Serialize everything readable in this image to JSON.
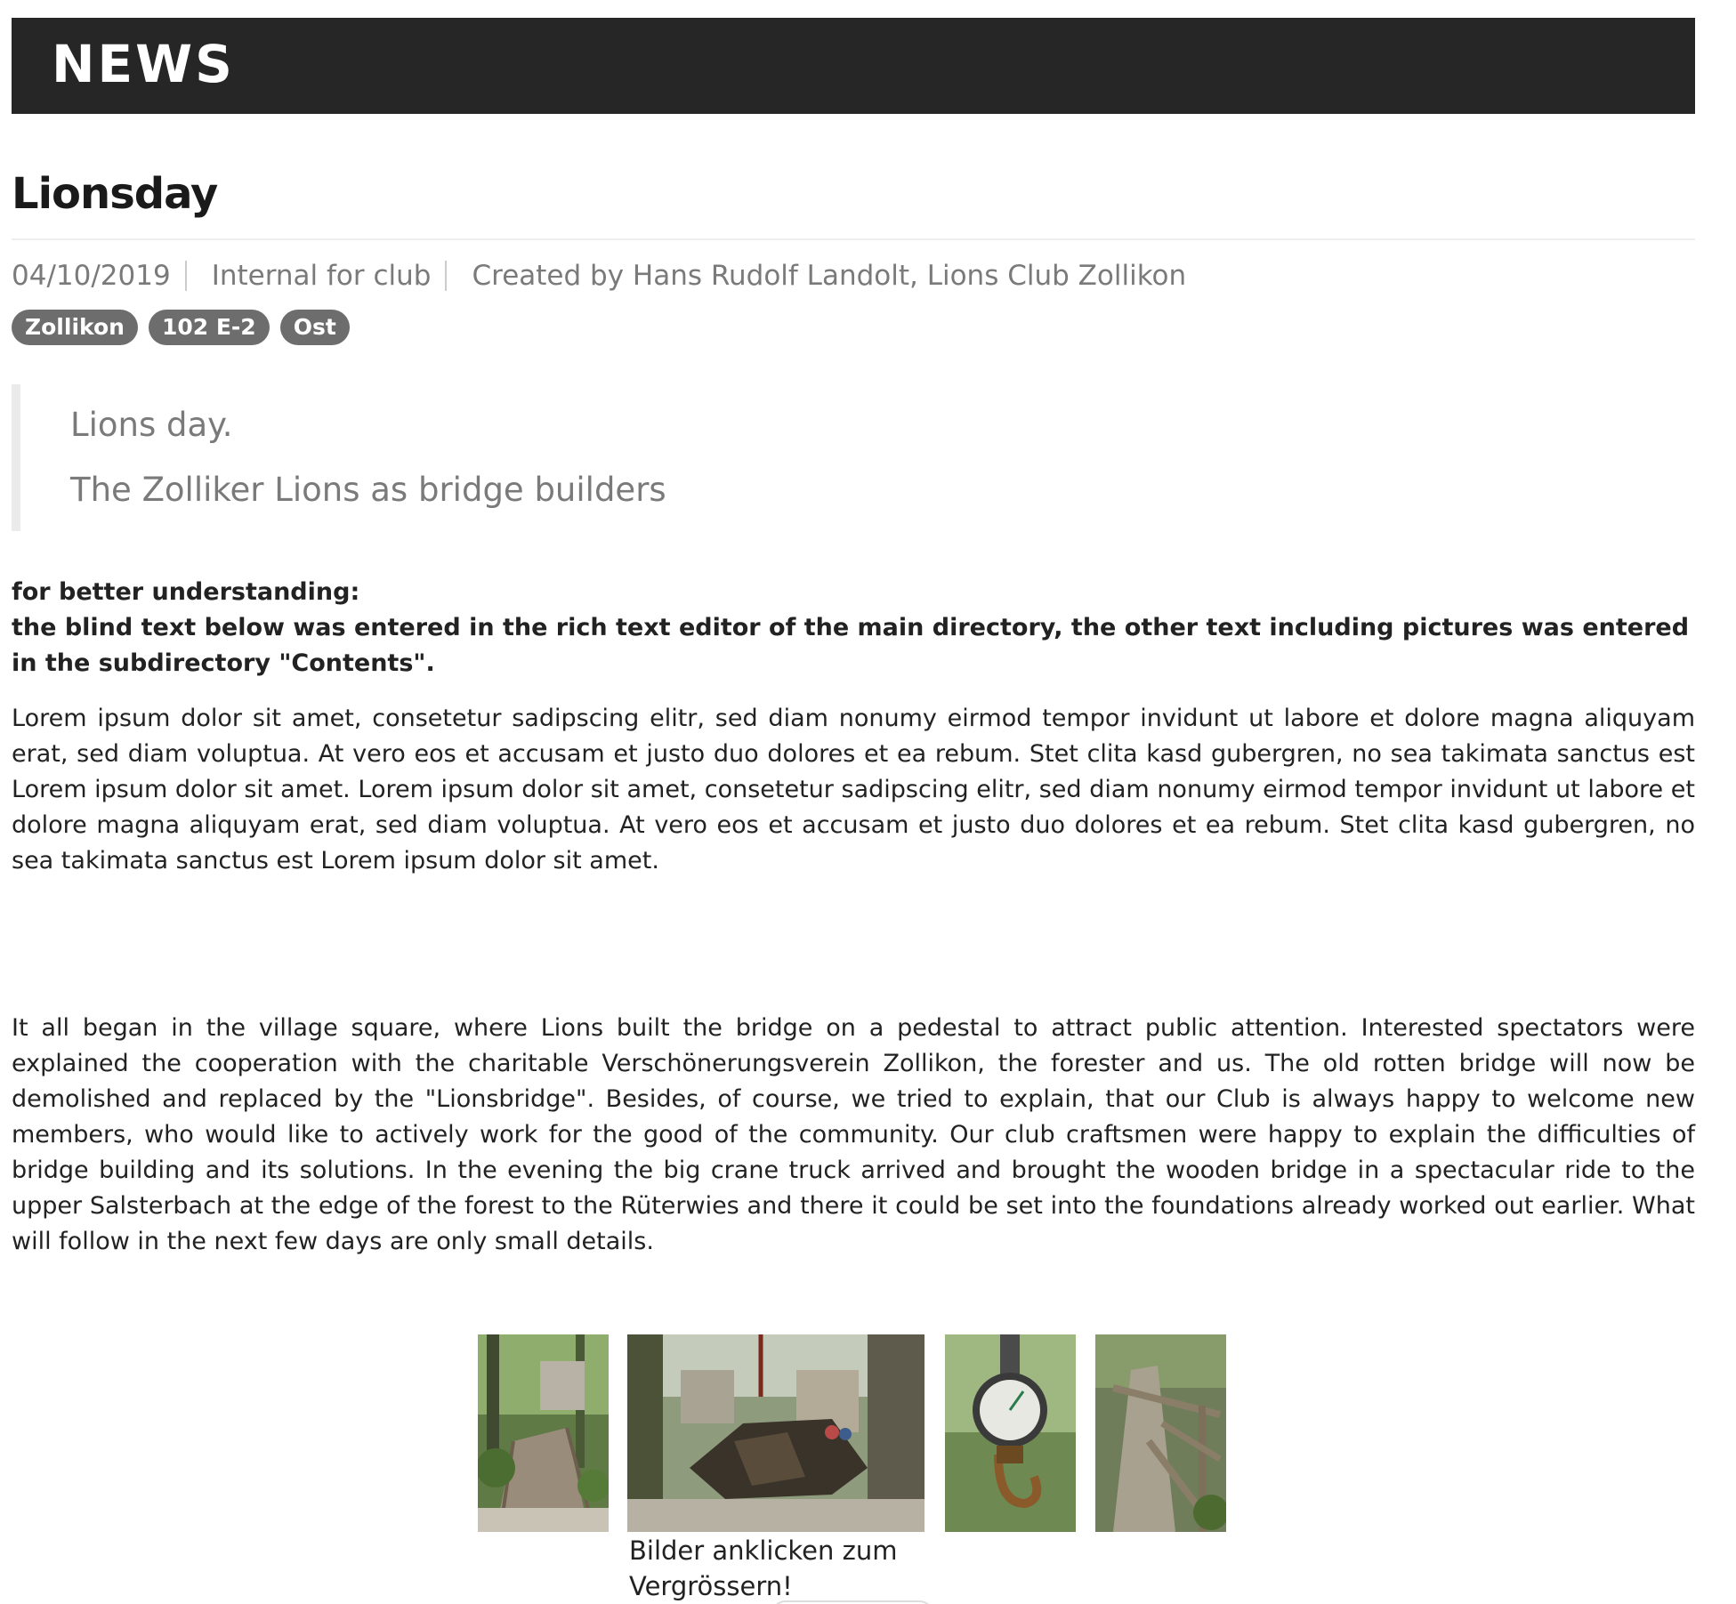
{
  "header": {
    "title": "NEWS"
  },
  "article": {
    "title": "Lionsday",
    "date": "04/10/2019",
    "visibility": "Internal for club",
    "created_by": "Created by Hans Rudolf Landolt, Lions Club Zollikon",
    "tags": [
      "Zollikon",
      "102 E-2",
      "Ost"
    ],
    "lead": [
      "Lions day.",
      "The Zolliker Lions as bridge builders"
    ],
    "intro_bold": [
      "for better understanding:",
      "the blind text below was entered in the rich text editor of the main directory, the other text including pictures was entered in the subdirectory \"Contents\"."
    ],
    "paragraphs": [
      "Lorem ipsum dolor sit amet, consetetur sadipscing elitr, sed diam nonumy eirmod tempor invidunt ut labore et dolore magna aliquyam erat, sed diam voluptua. At vero eos et accusam et justo duo dolores et ea rebum. Stet clita kasd gubergren, no sea takimata sanctus est Lorem ipsum dolor sit amet. Lorem ipsum dolor sit amet, consetetur sadipscing elitr, sed diam nonumy eirmod tempor invidunt ut labore et dolore magna aliquyam erat, sed diam voluptua. At vero eos et accusam et justo duo dolores et ea rebum. Stet clita kasd gubergren, no sea takimata sanctus est Lorem ipsum dolor sit amet.",
      "It all began in the village square, where Lions built the bridge on a pedestal to attract public attention. Interested spectators were explained the cooperation with the charitable Verschönerungsverein Zollikon, the forester and us. The old rotten bridge will now be demolished and replaced by the \"Lionsbridge\". Besides, of course, we tried to explain, that our Club is always happy to welcome new members, who would like to actively work for the good of the community. Our club craftsmen were happy to explain the difficulties of bridge building and its solutions. In the evening the big crane truck arrived and brought the wooden bridge in a spectacular ride to the upper Salsterbach at the edge of the forest to the Rüterwies and there it could be set into the foundations already worked out earlier. What will follow in the next few days are only small details."
    ]
  },
  "gallery": {
    "caption": "Bilder anklicken zum Vergrössern!",
    "photos": [
      "bridge-in-forest",
      "crane-lifting-bridge",
      "crane-scale-hook",
      "wooden-bridge-railing"
    ]
  }
}
